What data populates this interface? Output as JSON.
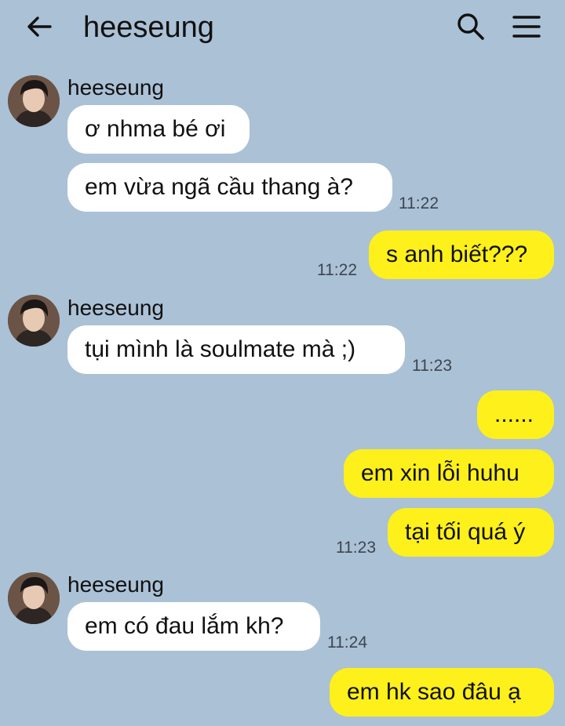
{
  "header": {
    "title": "heeseung",
    "back_icon": "arrow-left-icon",
    "search_icon": "search-icon",
    "menu_icon": "hamburger-menu-icon"
  },
  "messages": [
    {
      "from": "heeseung",
      "text": "ơ nhma bé ơi"
    },
    {
      "from": "heeseung",
      "text": "em vừa ngã cầu thang à?",
      "time": "11:22"
    },
    {
      "from": "me",
      "text": "s anh biết???",
      "time": "11:22"
    },
    {
      "from": "heeseung",
      "text": "tụi mình là soulmate mà ;)",
      "time": "11:23"
    },
    {
      "from": "me",
      "text": "......"
    },
    {
      "from": "me",
      "text": "em xin lỗi huhu"
    },
    {
      "from": "me",
      "text": "tại tối quá ý",
      "time": "11:23"
    },
    {
      "from": "heeseung",
      "text": "em có đau lắm kh?",
      "time": "11:24"
    },
    {
      "from": "me",
      "text": "em hk sao đâu ạ"
    }
  ],
  "colors": {
    "background": "#abc1d6",
    "incoming_bubble": "#ffffff",
    "outgoing_bubble": "#fef01b"
  }
}
